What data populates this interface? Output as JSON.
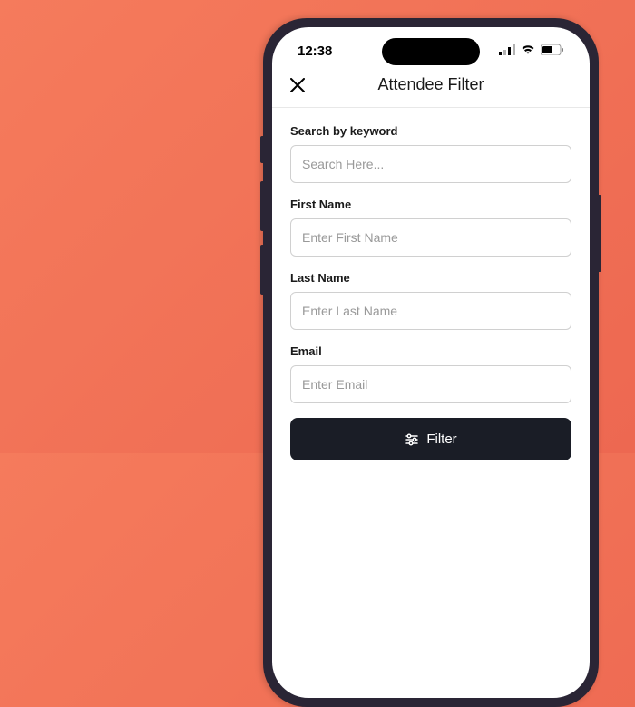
{
  "status_bar": {
    "time": "12:38"
  },
  "header": {
    "title": "Attendee Filter"
  },
  "form": {
    "fields": [
      {
        "label": "Search by keyword",
        "placeholder": "Search Here..."
      },
      {
        "label": "First Name",
        "placeholder": "Enter First Name"
      },
      {
        "label": "Last Name",
        "placeholder": "Enter Last Name"
      },
      {
        "label": "Email",
        "placeholder": "Enter Email"
      }
    ]
  },
  "filter_button": {
    "label": "Filter"
  }
}
